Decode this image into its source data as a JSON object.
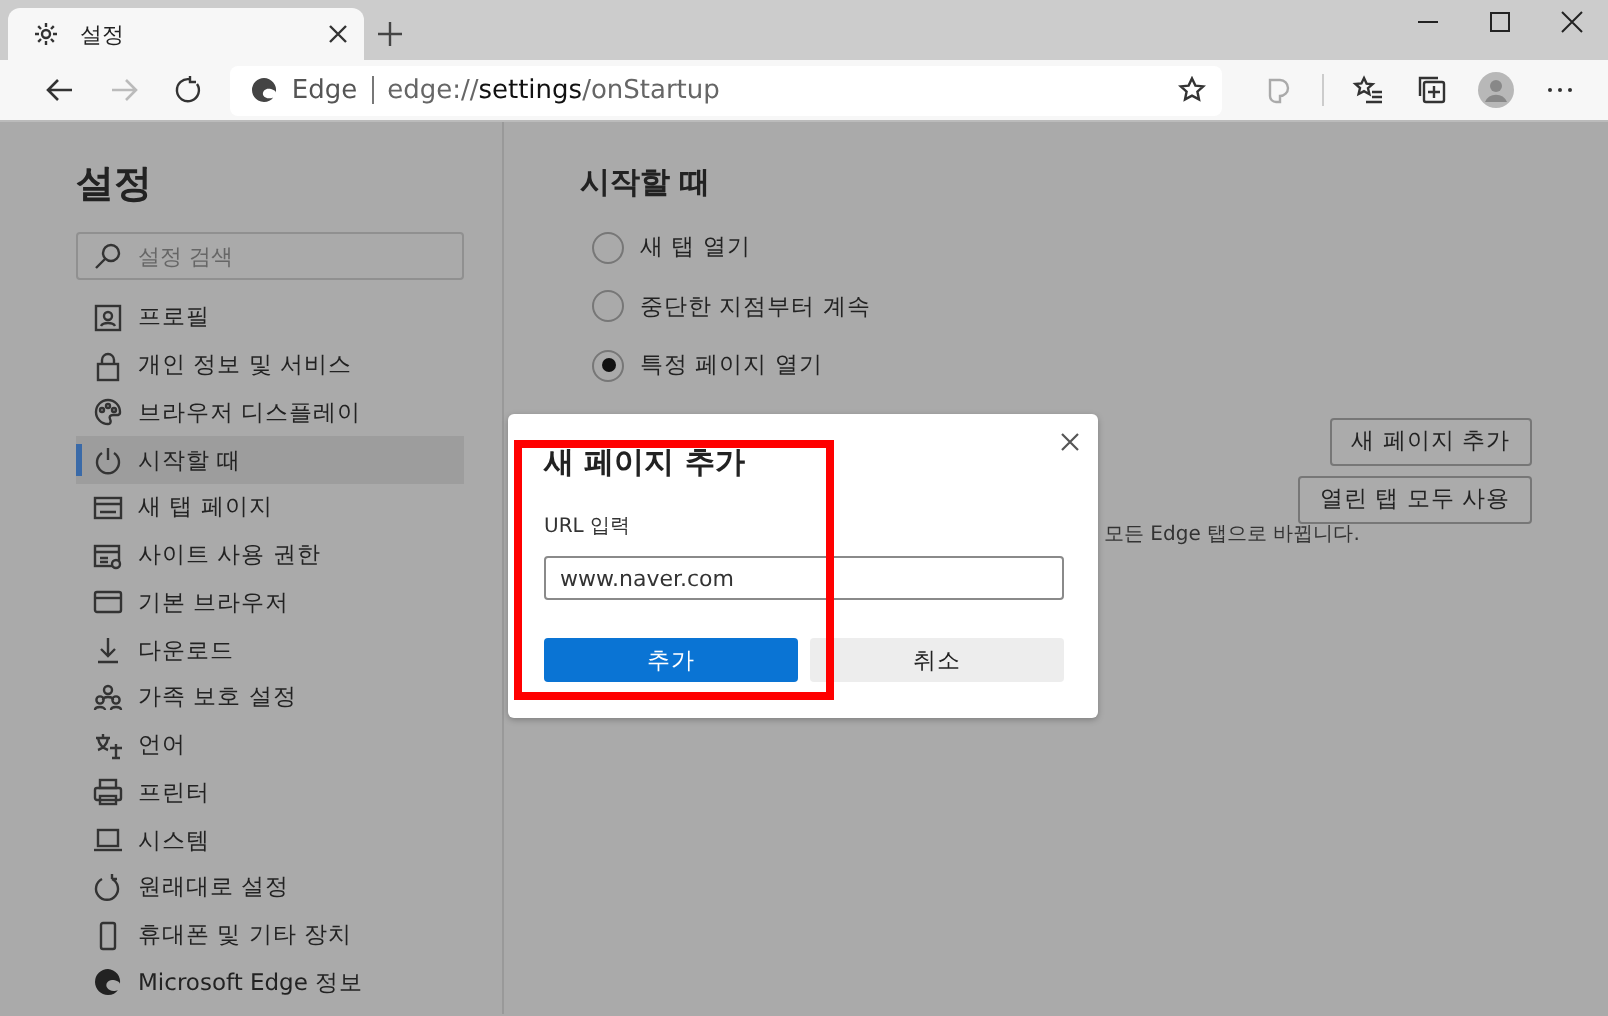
{
  "browser": {
    "tab": {
      "title": "설정",
      "selected": true
    },
    "address": {
      "site": "Edge",
      "url": "edge://**settings**/onStartup"
    }
  },
  "sidebar": {
    "title": "설정",
    "search": {
      "placeholder": "설정 검색"
    },
    "items": [
      {
        "label": "프로필",
        "kind": "profile",
        "selected": false
      },
      {
        "label": "개인 정보 및 서비스",
        "kind": "lock",
        "selected": false
      },
      {
        "label": "브라우저 디스플레이",
        "kind": "palette",
        "selected": false
      },
      {
        "label": "시작할 때",
        "kind": "power",
        "selected": true
      },
      {
        "label": "새 탭 페이지",
        "kind": "newtab",
        "selected": false
      },
      {
        "label": "사이트 사용 권한",
        "kind": "permissions",
        "selected": false
      },
      {
        "label": "기본 브라우저",
        "kind": "browser",
        "selected": false
      },
      {
        "label": "다운로드",
        "kind": "download",
        "selected": false
      },
      {
        "label": "가족 보호 설정",
        "kind": "family",
        "selected": false
      },
      {
        "label": "언어",
        "kind": "language",
        "selected": false
      },
      {
        "label": "프린터",
        "kind": "printer",
        "selected": false
      },
      {
        "label": "시스템",
        "kind": "laptop",
        "selected": false
      },
      {
        "label": "원래대로 설정",
        "kind": "reset",
        "selected": false
      },
      {
        "label": "휴대폰 및 기타 장치",
        "kind": "phone",
        "selected": false
      },
      {
        "label": "Microsoft Edge 정보",
        "kind": "edge",
        "selected": false
      }
    ]
  },
  "main": {
    "title": "시작할 때",
    "options": [
      {
        "label": "새 탭 열기",
        "selected": false
      },
      {
        "label": "중단한 지점부터 계속",
        "selected": false
      },
      {
        "label": "특정 페이지 열기",
        "selected": true
      }
    ],
    "buttons": [
      "새 페이지 추가",
      "열린 탭 모두 사용"
    ],
    "note": "모든 Edge 탭으로 바뀝니다."
  },
  "dialog": {
    "title": "새 페이지 추가",
    "field_label": "URL 입력",
    "field_value": "www.naver.com",
    "highlighted": true,
    "buttons": [
      {
        "label": "추가",
        "kind": "primary"
      },
      {
        "label": "취소",
        "kind": "secondary"
      }
    ]
  }
}
